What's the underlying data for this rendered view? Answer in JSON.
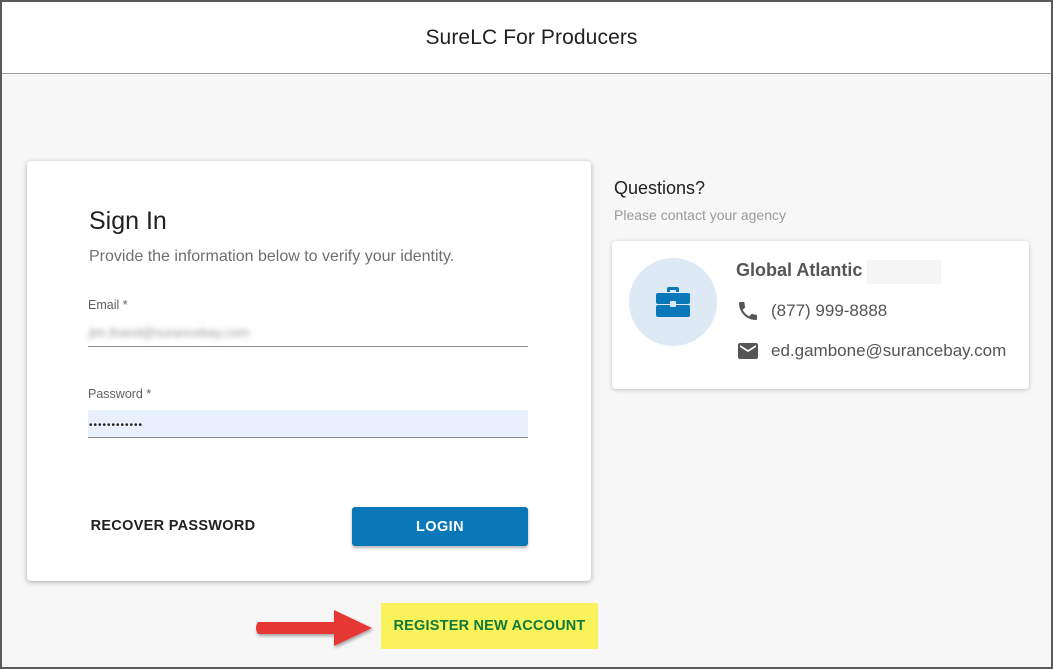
{
  "header": {
    "title": "SureLC For Producers"
  },
  "signin": {
    "title": "Sign In",
    "subtitle": "Provide the information below to verify your identity.",
    "email_label": "Email",
    "email_required": "*",
    "email_value": "jim.thand@surancebay.com",
    "password_label": "Password",
    "password_required": "*",
    "password_value": "••••••••••••",
    "recover_label": "RECOVER PASSWORD",
    "login_label": "LOGIN"
  },
  "register": {
    "label": "REGISTER NEW ACCOUNT",
    "highlight_color": "#f9f25a"
  },
  "questions": {
    "title": "Questions?",
    "subtitle": "Please contact your agency"
  },
  "contact": {
    "agency_name": "Global Atlantic",
    "phone": "(877) 999-8888",
    "email": "ed.gambone@surancebay.com",
    "icons": [
      "briefcase-icon",
      "phone-icon",
      "mail-icon"
    ]
  },
  "colors": {
    "accent": "#0a78b8",
    "annotation_arrow": "#e53935",
    "register_text": "#117a3a"
  }
}
